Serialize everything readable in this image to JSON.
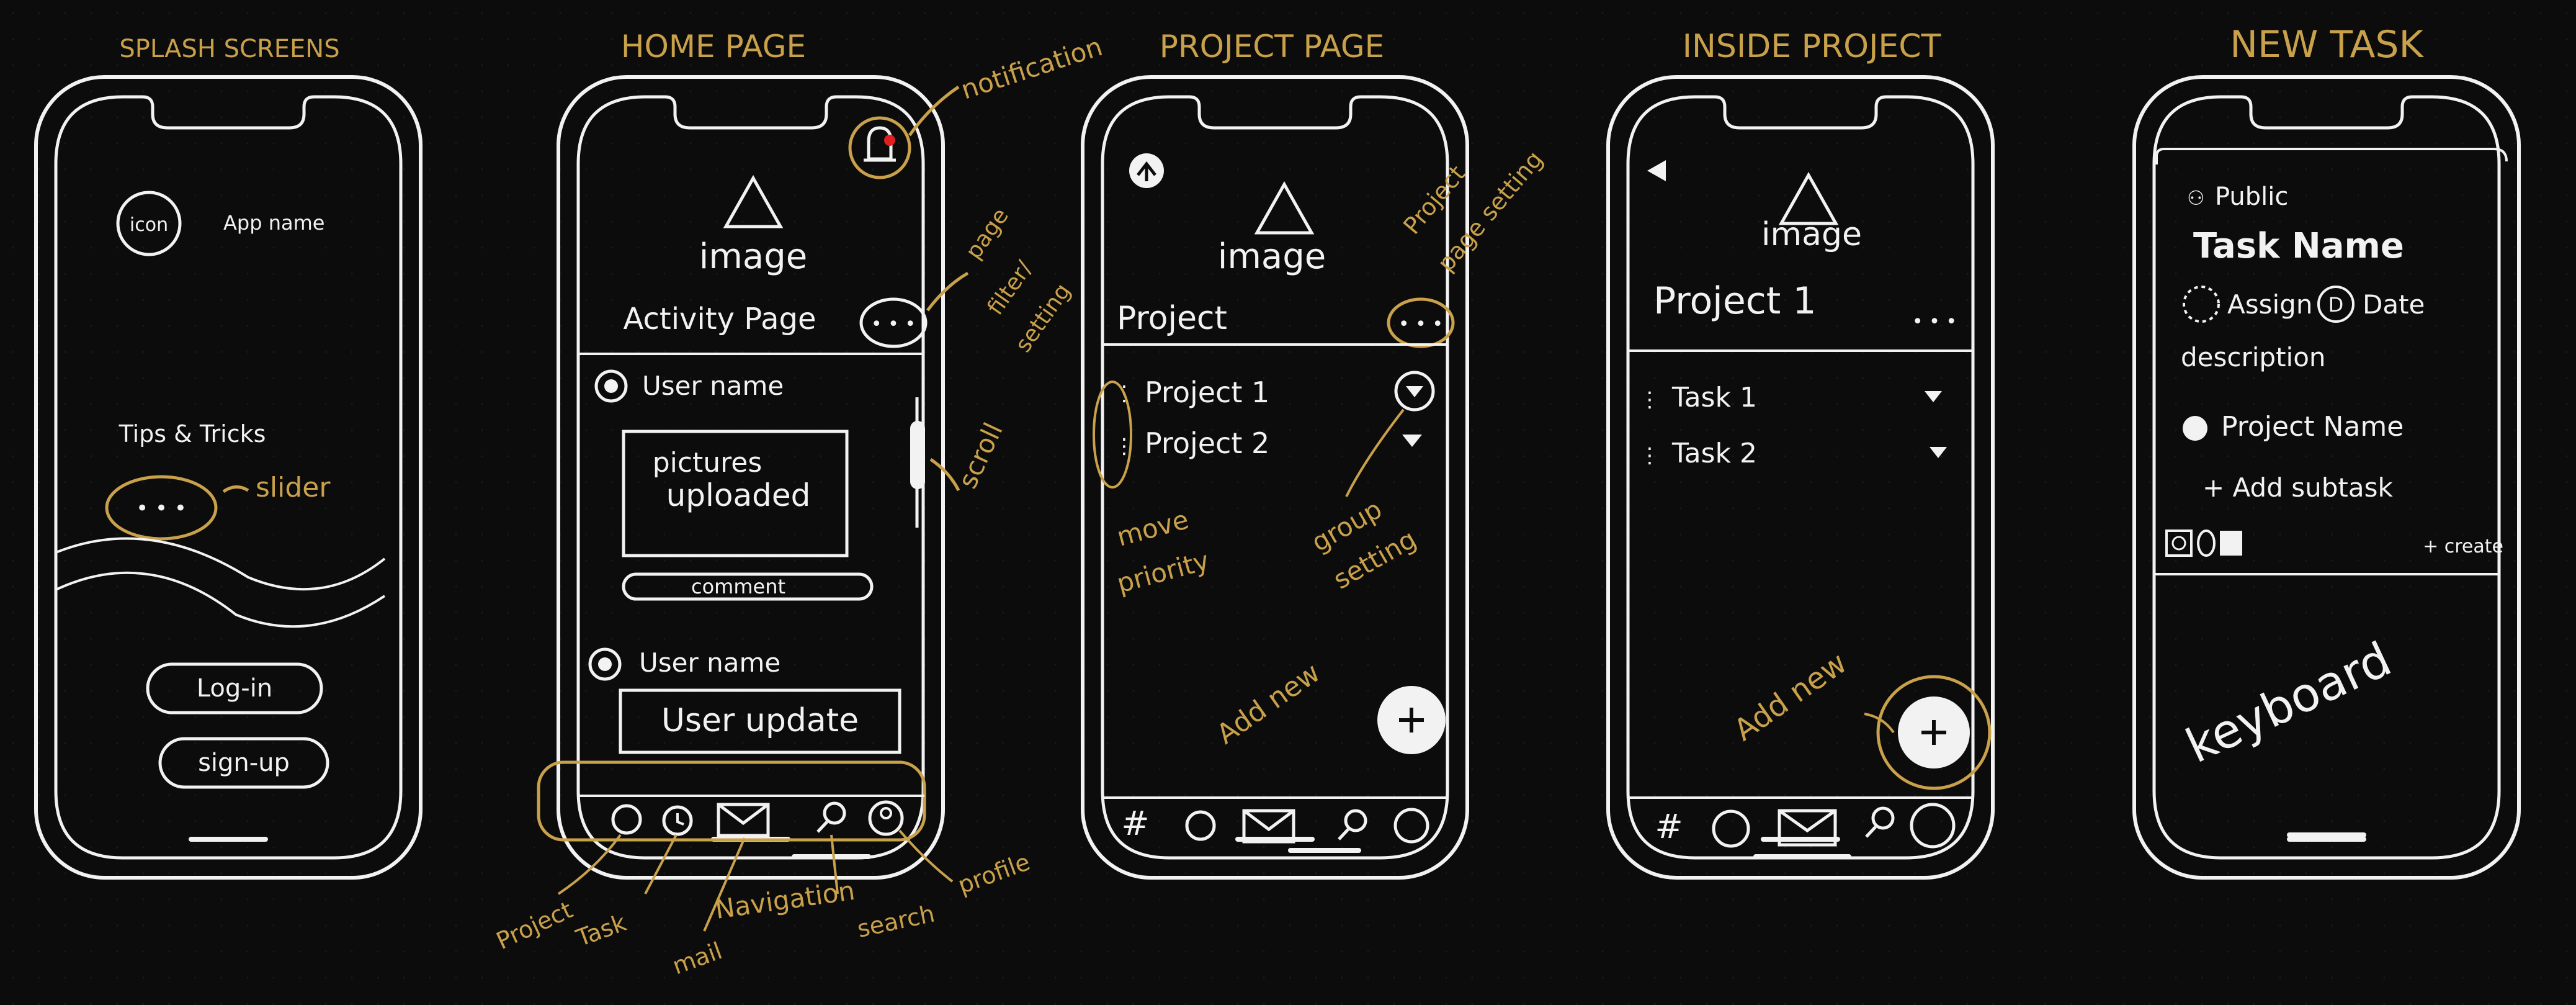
{
  "colors": {
    "background": "#0c0c0d",
    "ink": "#f2f2f2",
    "annotation": "#c9a14a",
    "notification_dot": "#e02020"
  },
  "screens": [
    {
      "title": "SPLASH SCREENS",
      "icon_label": "icon",
      "app_name": "App name",
      "tips": "Tips & Tricks",
      "dots": "• • •",
      "login": "Log-in",
      "signup": "sign-up",
      "annotations": {
        "slider": "slider"
      }
    },
    {
      "title": "HOME PAGE",
      "image_label": "image",
      "page_title": "Activity Page",
      "more": "• • •",
      "post1_user": "User name",
      "post1_content": [
        "pictures",
        "uploaded"
      ],
      "comment": "comment",
      "post2_user": "User name",
      "post2_content": "User update",
      "annotations": {
        "notification": "notification",
        "page_filter": [
          "page",
          "filter/",
          "setting"
        ],
        "scroll": "scroll",
        "project": "Project",
        "task": "Task",
        "navigation": "Navigation",
        "mail": "mail",
        "search": "search",
        "profile": "profile"
      }
    },
    {
      "title": "PROJECT PAGE",
      "image_label": "image",
      "page_title": "Project",
      "more": "• • •",
      "items": [
        "Project 1",
        "Project 2"
      ],
      "annotations": {
        "project_setting": [
          "Project",
          "page setting"
        ],
        "move_priority": [
          "move",
          "priority"
        ],
        "group_setting": [
          "group",
          "setting"
        ],
        "add_new": "Add new"
      }
    },
    {
      "title": "INSIDE PROJECT",
      "image_label": "image",
      "page_title": "Project 1",
      "more": "• • •",
      "items": [
        "Task 1",
        "Task 2"
      ],
      "annotations": {
        "add_new": "Add new"
      }
    },
    {
      "title": "NEW TASK",
      "visibility": "Public",
      "task_name": "Task Name",
      "assign": "Assign",
      "date_badge": "D",
      "date": "Date",
      "description": "description",
      "project_name": "Project Name",
      "add_subtask": "+ Add subtask",
      "create": "+ create",
      "keyboard": "keyboard"
    }
  ]
}
